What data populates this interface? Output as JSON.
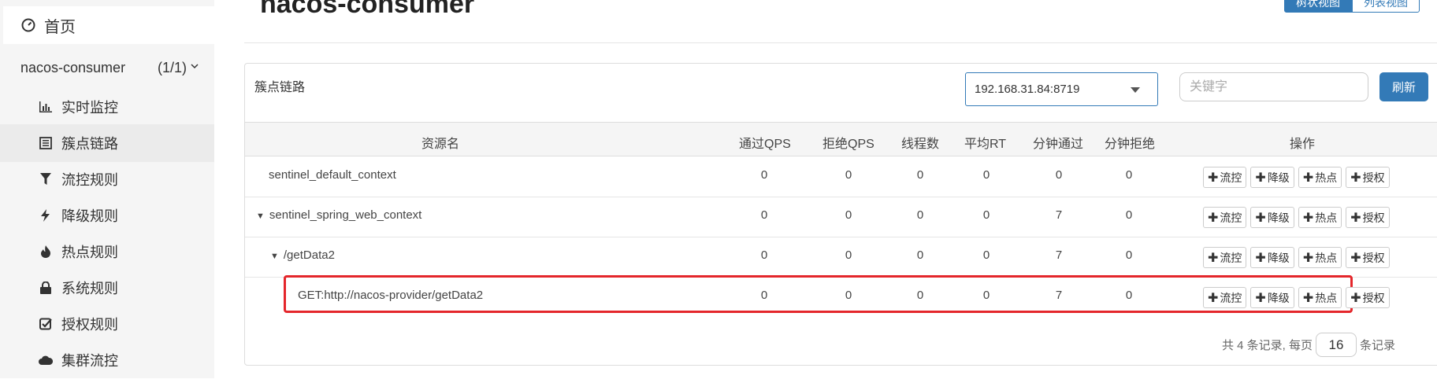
{
  "sidebar": {
    "home": "首页",
    "app": {
      "name": "nacos-consumer",
      "count": "(1/1)"
    },
    "items": [
      {
        "label": "实时监控"
      },
      {
        "label": "簇点链路"
      },
      {
        "label": "流控规则"
      },
      {
        "label": "降级规则"
      },
      {
        "label": "热点规则"
      },
      {
        "label": "系统规则"
      },
      {
        "label": "授权规则"
      },
      {
        "label": "集群流控"
      }
    ]
  },
  "header": {
    "title": "nacos-consumer",
    "view_tree": "树状视图",
    "view_list": "列表视图"
  },
  "panel": {
    "title": "簇点链路",
    "machine": "192.168.31.84:8719",
    "keyword_placeholder": "关键字",
    "refresh": "刷新"
  },
  "table": {
    "headers": [
      "资源名",
      "通过QPS",
      "拒绝QPS",
      "线程数",
      "平均RT",
      "分钟通过",
      "分钟拒绝",
      "操作"
    ],
    "rows": [
      {
        "name": "sentinel_default_context",
        "expand": "",
        "pass_qps": "0",
        "block_qps": "0",
        "threads": "0",
        "avg_rt": "0",
        "min_pass": "0",
        "min_block": "0"
      },
      {
        "name": "sentinel_spring_web_context",
        "expand": "▼",
        "pass_qps": "0",
        "block_qps": "0",
        "threads": "0",
        "avg_rt": "0",
        "min_pass": "7",
        "min_block": "0"
      },
      {
        "name": "/getData2",
        "expand": "▼",
        "pass_qps": "0",
        "block_qps": "0",
        "threads": "0",
        "avg_rt": "0",
        "min_pass": "7",
        "min_block": "0"
      },
      {
        "name": "GET:http://nacos-provider/getData2",
        "expand": "",
        "pass_qps": "0",
        "block_qps": "0",
        "threads": "0",
        "avg_rt": "0",
        "min_pass": "7",
        "min_block": "0"
      }
    ],
    "actions": [
      "流控",
      "降级",
      "热点",
      "授权"
    ]
  },
  "pagination": {
    "total": "共 4 条记录, 每页",
    "page_size": "16",
    "suffix": "条记录"
  },
  "colors": {
    "primary": "#337ab7",
    "highlight": "#e4262b"
  }
}
